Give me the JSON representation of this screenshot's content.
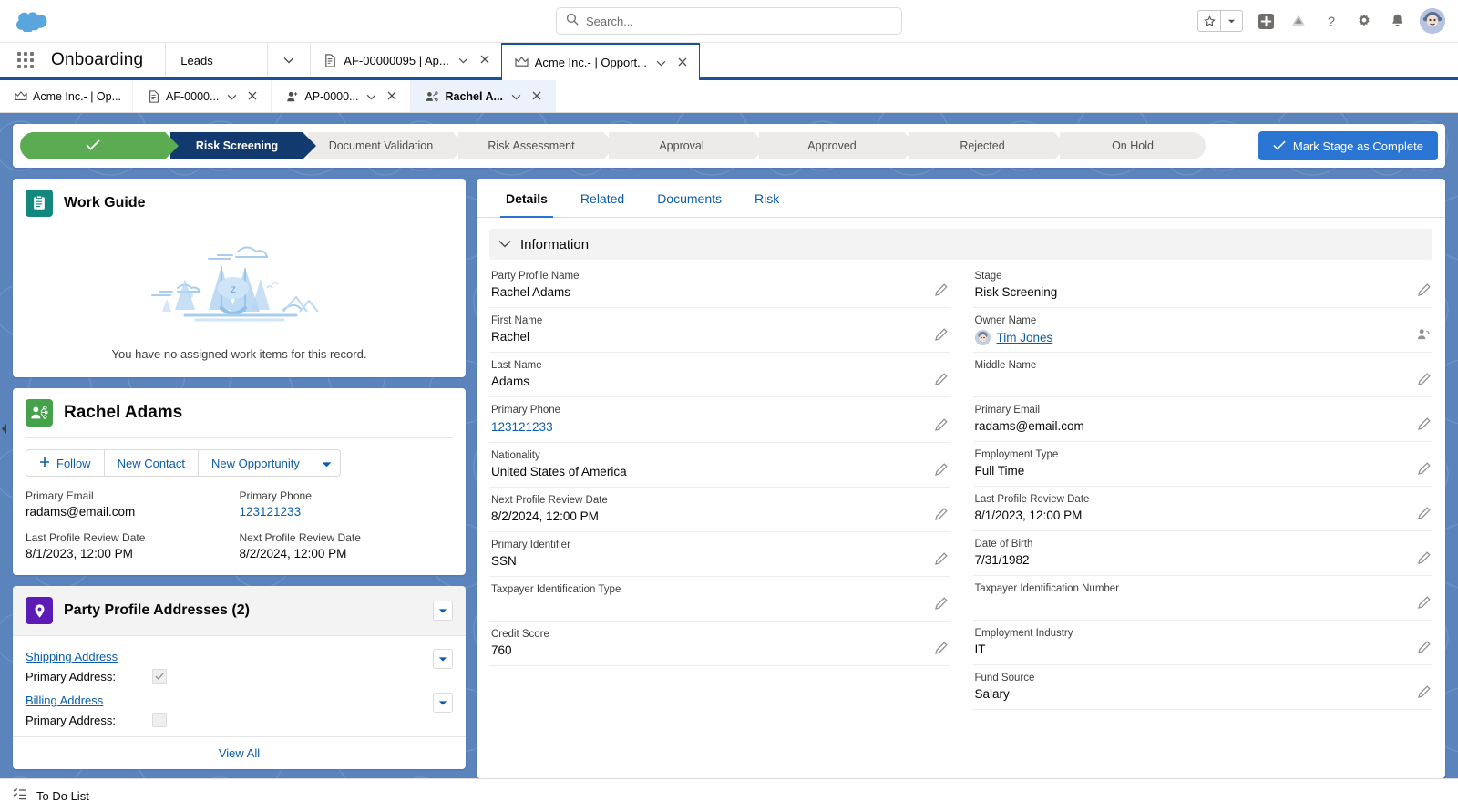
{
  "header": {
    "logo": "salesforce-cloud-logo",
    "search": {
      "placeholder": "Search...",
      "value": "",
      "icon": "search-icon"
    },
    "icons": [
      {
        "name": "favorites-star-icon",
        "glyph": "★"
      },
      {
        "name": "favorites-dropdown-icon",
        "glyph": "▾"
      },
      {
        "name": "global-actions-icon",
        "glyph": "+"
      },
      {
        "name": "learning-icon",
        "glyph": "☂"
      },
      {
        "name": "help-icon",
        "glyph": "?"
      },
      {
        "name": "setup-gear-icon",
        "glyph": "⚙"
      },
      {
        "name": "notifications-bell-icon",
        "glyph": "ὑ4"
      }
    ],
    "avatar": "user-avatar"
  },
  "app_nav": {
    "app_launcher": "app-launcher-icon",
    "app_name": "Onboarding",
    "items": [
      {
        "label": "Leads",
        "icon": null,
        "has_caret": false,
        "has_close": false,
        "active": false
      },
      {
        "label": "",
        "icon": null,
        "has_caret": true,
        "has_close": false,
        "active": false
      }
    ],
    "tabs": [
      {
        "label": "AF-00000095 | Ap...",
        "icon": "document-icon",
        "has_caret": true,
        "has_close": true,
        "active": false
      },
      {
        "label": "Acme Inc.- | Opport...",
        "icon": "opportunity-crown-icon",
        "has_caret": true,
        "has_close": true,
        "active": true
      }
    ]
  },
  "sub_tabs": [
    {
      "label": "Acme Inc.- | Op...",
      "icon": "opportunity-crown-icon",
      "has_caret": false,
      "has_close": false,
      "active": false
    },
    {
      "label": "AF-0000...",
      "icon": "document-icon",
      "has_caret": true,
      "has_close": true,
      "active": false
    },
    {
      "label": "AP-0000...",
      "icon": "person-plus-icon",
      "has_caret": true,
      "has_close": true,
      "active": false
    },
    {
      "label": "Rachel A...",
      "icon": "party-profile-icon",
      "has_caret": true,
      "has_close": true,
      "active": true
    }
  ],
  "path": {
    "steps": [
      {
        "label": "",
        "state": "complete",
        "icon": "check-icon"
      },
      {
        "label": "Risk Screening",
        "state": "current"
      },
      {
        "label": "Document Validation",
        "state": "upcoming"
      },
      {
        "label": "Risk Assessment",
        "state": "upcoming"
      },
      {
        "label": "Approval",
        "state": "upcoming"
      },
      {
        "label": "Approved",
        "state": "upcoming"
      },
      {
        "label": "Rejected",
        "state": "upcoming"
      },
      {
        "label": "On Hold",
        "state": "upcoming"
      }
    ],
    "mark_complete_label": "Mark Stage as Complete",
    "mark_complete_icon": "check-icon",
    "accent_color": "#2a74d4",
    "complete_color": "#5bab52",
    "current_color": "#133a6f"
  },
  "work_guide": {
    "title": "Work Guide",
    "icon": "work-guide-clipboard-icon",
    "empty_text": "You have no assigned work items for this record.",
    "illustration": "camping-hammock-illustration"
  },
  "person_card": {
    "title": "Rachel Adams",
    "icon": "party-profile-icon",
    "buttons": [
      {
        "label": "Follow",
        "icon": "plus-icon"
      },
      {
        "label": "New Contact",
        "icon": null
      },
      {
        "label": "New Opportunity",
        "icon": null
      },
      {
        "label": "",
        "icon": "chevron-down-icon"
      }
    ],
    "fields": [
      {
        "label": "Primary Email",
        "value": "radams@email.com",
        "is_link": false
      },
      {
        "label": "Primary Phone",
        "value": "123121233",
        "is_link": true
      },
      {
        "label": "Last Profile Review Date",
        "value": "8/1/2023, 12:00 PM",
        "is_link": false
      },
      {
        "label": "Next Profile Review Date",
        "value": "8/2/2024, 12:00 PM",
        "is_link": false
      }
    ]
  },
  "addresses": {
    "title": "Party Profile Addresses (2)",
    "icon": "location-pin-icon",
    "rows": [
      {
        "link": "Shipping Address",
        "field_label": "Primary Address:",
        "checked": true
      },
      {
        "link": "Billing Address",
        "field_label": "Primary Address:",
        "checked": false
      }
    ],
    "view_all": "View All"
  },
  "details": {
    "tabs": [
      {
        "label": "Details",
        "active": true
      },
      {
        "label": "Related",
        "active": false
      },
      {
        "label": "Documents",
        "active": false
      },
      {
        "label": "Risk",
        "active": false
      }
    ],
    "section_title": "Information",
    "section_icon": "chevron-down-icon",
    "left_fields": [
      {
        "label": "Party Profile Name",
        "value": "Rachel Adams",
        "type": "text",
        "action": "pencil-icon"
      },
      {
        "label": "First Name",
        "value": "Rachel",
        "type": "text",
        "action": "pencil-icon"
      },
      {
        "label": "Last Name",
        "value": "Adams",
        "type": "text",
        "action": "pencil-icon"
      },
      {
        "label": "Primary Phone",
        "value": "123121233",
        "type": "link",
        "action": "pencil-icon"
      },
      {
        "label": "Nationality",
        "value": "United States of America",
        "type": "text",
        "action": "pencil-icon"
      },
      {
        "label": "Next Profile Review Date",
        "value": "8/2/2024, 12:00 PM",
        "type": "text",
        "action": "pencil-icon"
      },
      {
        "label": "Primary Identifier",
        "value": "SSN",
        "type": "text",
        "action": "pencil-icon"
      },
      {
        "label": "Taxpayer Identification Type",
        "value": "",
        "type": "text",
        "action": "pencil-icon"
      },
      {
        "label": "Credit Score",
        "value": "760",
        "type": "text",
        "action": "pencil-icon"
      }
    ],
    "right_fields": [
      {
        "label": "Stage",
        "value": "Risk Screening",
        "type": "text",
        "action": "pencil-icon"
      },
      {
        "label": "Owner Name",
        "value": "Tim Jones",
        "type": "owner",
        "action": "change-owner-icon"
      },
      {
        "label": "Middle Name",
        "value": "",
        "type": "text",
        "action": "pencil-icon"
      },
      {
        "label": "Primary Email",
        "value": "radams@email.com",
        "type": "text",
        "action": "pencil-icon"
      },
      {
        "label": "Employment Type",
        "value": "Full Time",
        "type": "text",
        "action": "pencil-icon"
      },
      {
        "label": "Last Profile Review Date",
        "value": "8/1/2023, 12:00 PM",
        "type": "text",
        "action": "pencil-icon"
      },
      {
        "label": "Date of Birth",
        "value": "7/31/1982",
        "type": "text",
        "action": "pencil-icon"
      },
      {
        "label": "Taxpayer Identification Number",
        "value": "",
        "type": "text",
        "action": "pencil-icon"
      },
      {
        "label": "Employment Industry",
        "value": "IT",
        "type": "text",
        "action": "pencil-icon"
      },
      {
        "label": "Fund Source",
        "value": "Salary",
        "type": "text",
        "action": "pencil-icon"
      }
    ]
  },
  "footer": {
    "label": "To Do List",
    "icon": "todo-list-icon"
  }
}
